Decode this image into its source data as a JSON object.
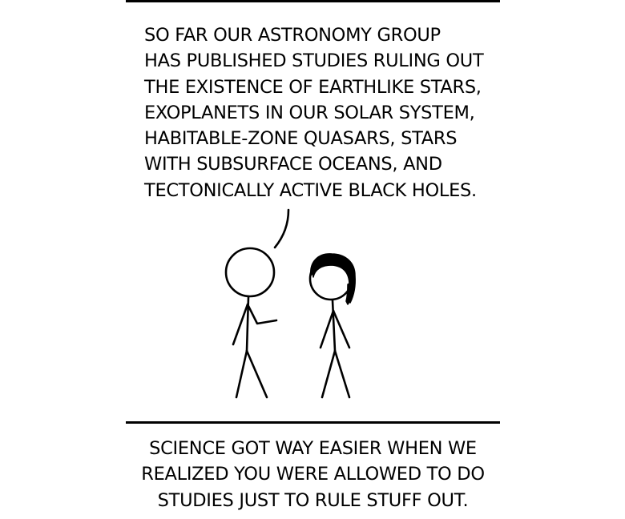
{
  "panel": {
    "speech_lines": [
      "SO FAR OUR ASTRONOMY GROUP",
      "HAS PUBLISHED STUDIES RULING OUT",
      "THE EXISTENCE OF EARTHLIKE STARS,",
      "EXOPLANETS IN OUR SOLAR SYSTEM,",
      "HABITABLE-ZONE QUASARS, STARS",
      "WITH SUBSURFACE OCEANS, AND",
      "TECTONICALLY ACTIVE BLACK HOLES."
    ]
  },
  "caption": {
    "lines": [
      "SCIENCE GOT WAY EASIER WHEN WE",
      "REALIZED YOU WERE ALLOWED TO DO",
      "STUDIES JUST TO RULE STUFF OUT."
    ]
  },
  "colors": {
    "ink": "#000000",
    "background": "#ffffff"
  }
}
